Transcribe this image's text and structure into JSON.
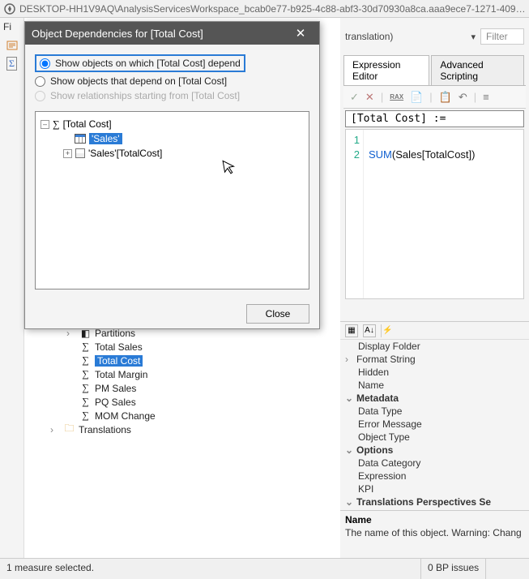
{
  "titlebar": {
    "path": "DESKTOP-HH1V9AQ\\AnalysisServicesWorkspace_bcab0e77-b925-4c88-abf3-30d70930a8ca.aaa9ece7-1271-409…"
  },
  "leftStrip": {
    "label": "Fi"
  },
  "topRow": {
    "translation": "translation)",
    "dropdown": "▾",
    "filter": "Filter"
  },
  "tabs": {
    "expr": "Expression Editor",
    "adv": "Advanced Scripting"
  },
  "toolbar": {
    "check": "✓",
    "x": "✕",
    "dax": "RAX",
    "doc": "📄",
    "copy": "📋",
    "undo": "↶",
    "redo": "↷",
    "more": "≡"
  },
  "header": "[Total Cost] :=",
  "code": {
    "line1": "1",
    "line2": "2",
    "fn": "SUM",
    "rest": "(Sales[TotalCost])"
  },
  "propToolbar": {
    "a": "▦",
    "b": "A↓",
    "c": "⚡"
  },
  "props": {
    "display_folder": "Display Folder",
    "format_string": "Format String",
    "hidden": "Hidden",
    "name": "Name",
    "metadata": "Metadata",
    "data_type": "Data Type",
    "error_message": "Error Message",
    "object_type": "Object Type",
    "options": "Options",
    "data_category": "Data Category",
    "expression": "Expression",
    "kpi": "KPI",
    "translations": "Translations  Perspectives  Se"
  },
  "propDesc": {
    "name": "Name",
    "text": "The name of this object. Warning: Chang"
  },
  "tree": {
    "partitions": "Partitions",
    "total_sales": "Total Sales",
    "total_cost": "Total Cost",
    "total_margin": "Total Margin",
    "pm_sales": "PM Sales",
    "pq_sales": "PQ Sales",
    "mom_change": "MOM Change",
    "translations": "Translations"
  },
  "dialog": {
    "title": "Object Dependencies for [Total Cost]",
    "radio1": "Show objects on which [Total Cost] depend",
    "radio2": "Show objects that depend on [Total Cost]",
    "radio3": "Show relationships starting from [Total Cost]",
    "tree": {
      "root": "[Total Cost]",
      "sales": "'Sales'",
      "salescol": "'Sales'[TotalCost]"
    },
    "close": "Close"
  },
  "status": {
    "left": "1 measure selected.",
    "right": "0 BP issues"
  }
}
